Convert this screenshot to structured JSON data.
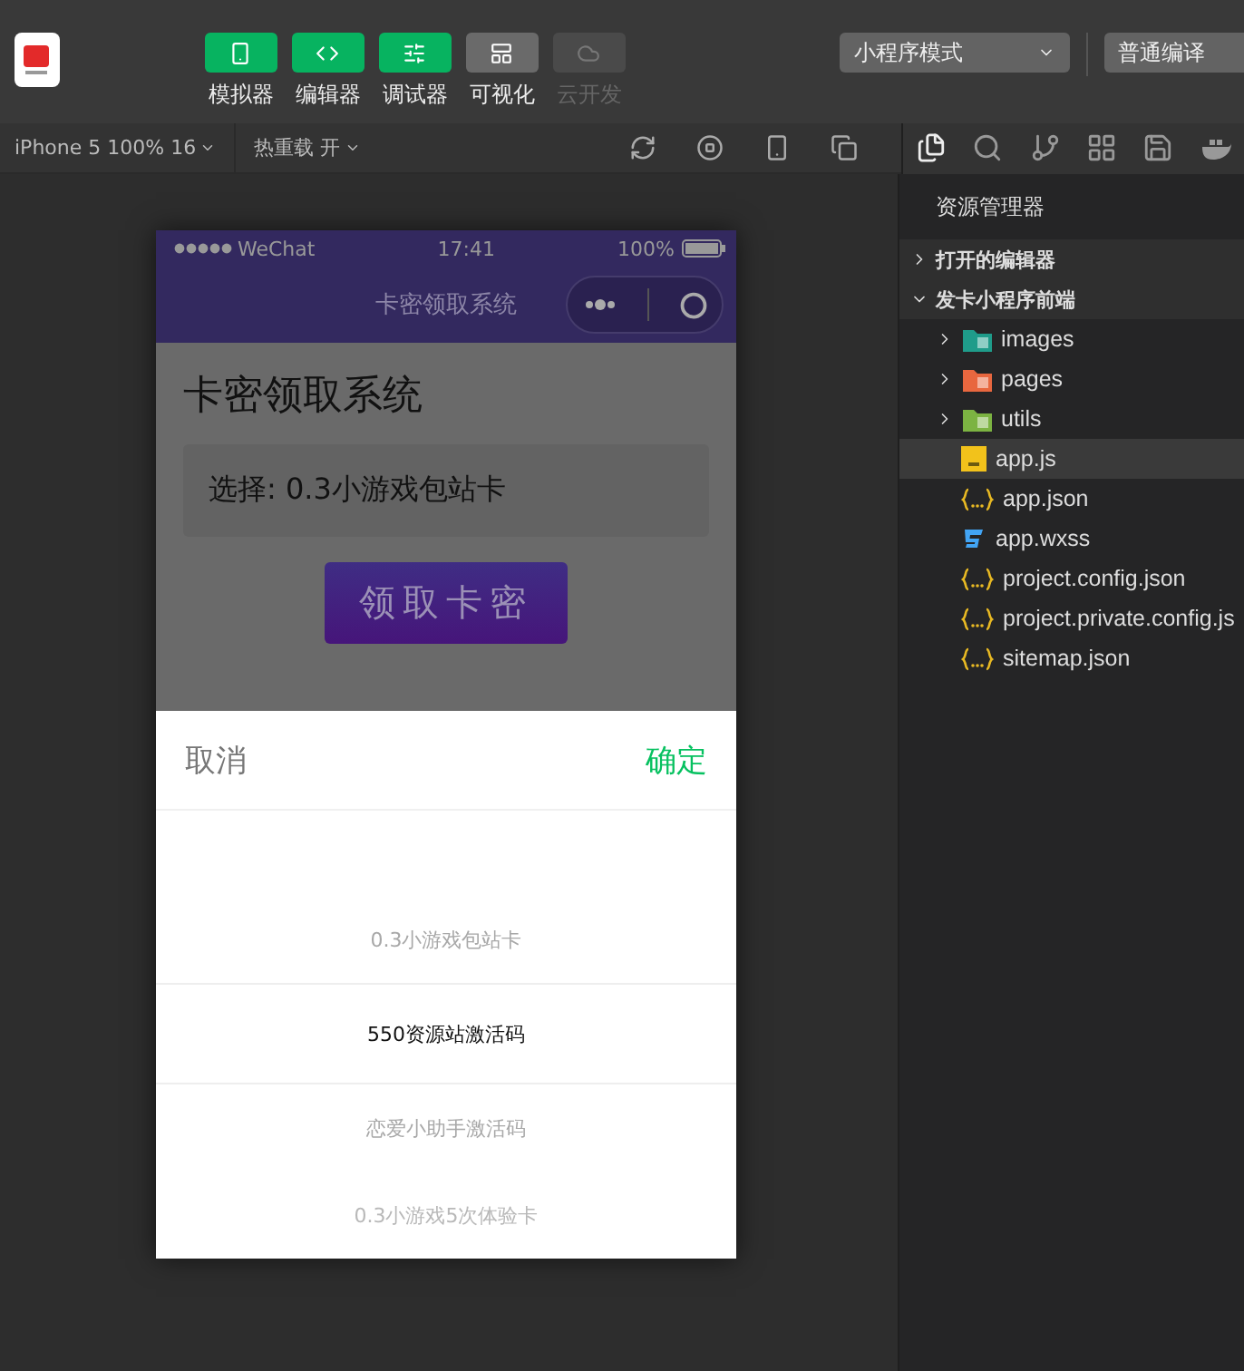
{
  "toolbar": {
    "tools": [
      {
        "label": "模拟器",
        "kind": "phone",
        "on": true,
        "disabled": false
      },
      {
        "label": "编辑器",
        "kind": "code",
        "on": true,
        "disabled": false
      },
      {
        "label": "调试器",
        "kind": "sliders",
        "on": true,
        "disabled": false
      },
      {
        "label": "可视化",
        "kind": "layout",
        "on": false,
        "disabled": false
      },
      {
        "label": "云开发",
        "kind": "cloud",
        "on": false,
        "disabled": true
      }
    ],
    "mode": "小程序模式",
    "compile": "普通编译"
  },
  "simulator_bar": {
    "device": "iPhone 5 100% 16",
    "hot_reload": "热重载 开"
  },
  "phone": {
    "status": {
      "carrier": "WeChat",
      "time": "17:41",
      "battery": "100%"
    },
    "nav_title": "卡密领取系统",
    "heading": "卡密领取系统",
    "selection": "选择: 0.3小游戏包站卡",
    "button": "领取卡密",
    "picker": {
      "cancel": "取消",
      "confirm": "确定",
      "options": [
        {
          "label": "0.3小游戏包站卡",
          "selected": false
        },
        {
          "label": "550资源站激活码",
          "selected": true
        },
        {
          "label": "恋爱小助手激活码",
          "selected": false
        },
        {
          "label": "0.3小游戏5次体验卡",
          "selected": false
        }
      ]
    }
  },
  "explorer": {
    "title": "资源管理器",
    "sections": [
      {
        "label": "打开的编辑器",
        "expanded": false
      },
      {
        "label": "发卡小程序前端",
        "expanded": true,
        "children": [
          {
            "name": "images",
            "kind": "folder-images",
            "expanded": false,
            "selected": false
          },
          {
            "name": "pages",
            "kind": "folder-pages",
            "expanded": false,
            "selected": false
          },
          {
            "name": "utils",
            "kind": "folder-utils",
            "expanded": false,
            "selected": false
          },
          {
            "name": "app.js",
            "kind": "js",
            "selected": true
          },
          {
            "name": "app.json",
            "kind": "json",
            "selected": false
          },
          {
            "name": "app.wxss",
            "kind": "css",
            "selected": false
          },
          {
            "name": "project.config.json",
            "kind": "json",
            "selected": false
          },
          {
            "name": "project.private.config.js",
            "kind": "json",
            "selected": false
          },
          {
            "name": "sitemap.json",
            "kind": "json",
            "selected": false
          }
        ]
      }
    ]
  }
}
